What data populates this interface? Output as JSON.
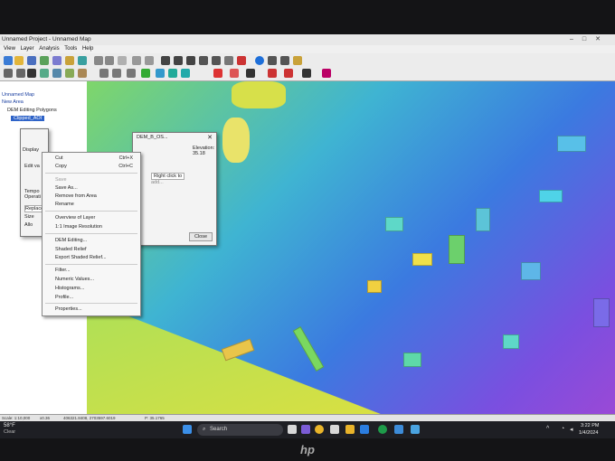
{
  "window": {
    "title": "Unnamed Project - Unnamed Map"
  },
  "menu_bar": [
    "View",
    "Layer",
    "Analysis",
    "Tools",
    "Help"
  ],
  "layers_panel": {
    "items": [
      "Unnamed Map",
      "New Area",
      "DEM Editing Polygons",
      "Clipped_AOI"
    ]
  },
  "context_menu": {
    "items": [
      {
        "label": "Cut",
        "shortcut": "Ctrl+X"
      },
      {
        "label": "Copy",
        "shortcut": "Ctrl+C"
      },
      {
        "label": "Save",
        "shortcut": ""
      },
      {
        "label": "Save As...",
        "shortcut": ""
      },
      {
        "label": "Remove from Area",
        "shortcut": ""
      },
      {
        "label": "Rename",
        "shortcut": ""
      },
      {
        "label": "Overview of Layer",
        "shortcut": ""
      },
      {
        "label": "1:1 Image Resolution",
        "shortcut": ""
      },
      {
        "label": "DEM Editing...",
        "shortcut": ""
      },
      {
        "label": "Shaded Relief",
        "shortcut": ""
      },
      {
        "label": "Export Shaded Relief...",
        "shortcut": ""
      },
      {
        "label": "Filter...",
        "shortcut": ""
      },
      {
        "label": "Numeric Values...",
        "shortcut": ""
      },
      {
        "label": "Histograms...",
        "shortcut": ""
      },
      {
        "label": "Profile...",
        "shortcut": ""
      },
      {
        "label": "Properties...",
        "shortcut": ""
      }
    ]
  },
  "dem_dialog": {
    "title": "DEM_B_OS...",
    "elevation_label": "Elevation:",
    "elevation_value": "35.18",
    "hint": "Right click to",
    "hint2": "add...",
    "close_label": "Close"
  },
  "side_dialog": {
    "labels": [
      "Display",
      "Edit va",
      "Tempo",
      "Operati",
      "Replace",
      "Size",
      "Allo"
    ]
  },
  "status_bar": {
    "scale": "Scale: 1:10,000",
    "zoom": "x0.36",
    "coords": "406321.8408, 2703597.6019",
    "pixel": "P: 35.1765"
  },
  "taskbar": {
    "search_label": "Search",
    "weather_temp": "58°F",
    "weather_text": "Clear",
    "time": "3:22 PM",
    "date": "1/4/2024"
  },
  "colors": {
    "map_green": "#7fd66a",
    "map_cyan": "#3fb4d2",
    "map_blue": "#3b7ae0",
    "map_purple": "#9a49d6",
    "taskbar": "#1e1f24"
  },
  "brand": "hp"
}
